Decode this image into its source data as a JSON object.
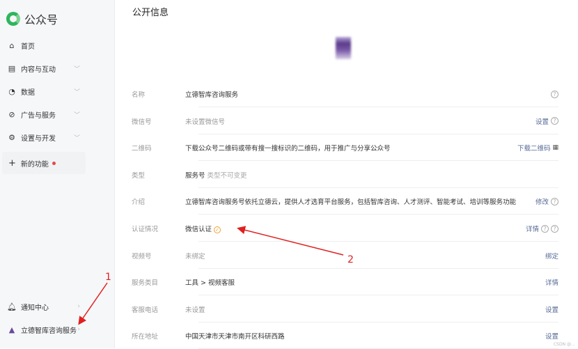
{
  "brand": {
    "name": "公众号",
    "color": "#2fb55c"
  },
  "sidebar": {
    "items": [
      {
        "label": "首页",
        "icon": "home-icon"
      },
      {
        "label": "内容与互动",
        "icon": "document-icon",
        "expandable": true
      },
      {
        "label": "数据",
        "icon": "pie-chart-icon",
        "expandable": true
      },
      {
        "label": "广告与服务",
        "icon": "compass-icon",
        "expandable": true
      },
      {
        "label": "设置与开发",
        "icon": "gear-icon",
        "expandable": true
      }
    ],
    "new_feature": {
      "label": "新的功能",
      "badge_color": "#e24a4a"
    },
    "notifications": {
      "label": "通知中心"
    },
    "account": {
      "label": "立德智库咨询服务"
    }
  },
  "main": {
    "title": "公开信息",
    "rows": [
      {
        "label": "名称",
        "value": "立德智库咨询服务",
        "action": "",
        "help": 1
      },
      {
        "label": "微信号",
        "value": "未设置微信号",
        "muted": true,
        "action": "设置",
        "help": 1
      },
      {
        "label": "二维码",
        "value": "下载公众号二维码或带有搜一搜标识的二维码，用于推广与分享公众号",
        "action": "下载二维码",
        "qr": true
      },
      {
        "label": "类型",
        "value": "服务号",
        "sub": "类型不可变更",
        "action": ""
      },
      {
        "label": "介绍",
        "value": "立德智库咨询服务号依托立德云，提供人才选育平台服务，包括智库咨询、人才测评、智能考试、培训等服务功能",
        "action": "修改",
        "help": 1
      },
      {
        "label": "认证情况",
        "value": "微信认证",
        "verified": true,
        "action": "详情",
        "help": 2
      },
      {
        "label": "视频号",
        "value": "未绑定",
        "muted": true,
        "action": "绑定"
      },
      {
        "label": "服务类目",
        "value": "工具 > 视频客服",
        "action": "详情"
      },
      {
        "label": "客服电话",
        "value": "未设置",
        "muted": true,
        "action": "设置"
      },
      {
        "label": "所在地址",
        "value": "中国天津市天津市南开区科研西路",
        "action": "设置"
      }
    ]
  },
  "annotations": {
    "one": "1",
    "two": "2",
    "color": "#e02020"
  },
  "watermark": "CSDN @初九之潜龙勿用"
}
